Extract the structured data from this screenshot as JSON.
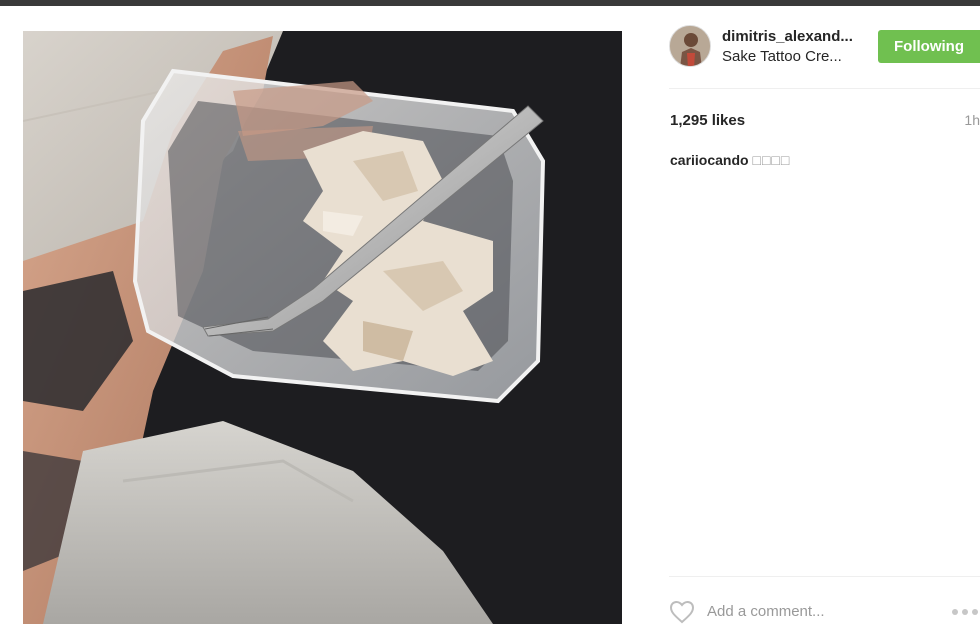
{
  "header": {
    "username": "dimitris_alexand...",
    "location": "Sake Tattoo Cre...",
    "follow_label": "Following"
  },
  "post": {
    "likes": "1,295 likes",
    "time": "1h",
    "caption_user": "cariiocando",
    "caption_text": "□□□□"
  },
  "comment_box": {
    "placeholder": "Add a comment..."
  },
  "icons": {
    "like": "heart-icon",
    "options": "more-options-icon"
  },
  "colors": {
    "follow_button": "#70c050",
    "muted_text": "#999999"
  }
}
